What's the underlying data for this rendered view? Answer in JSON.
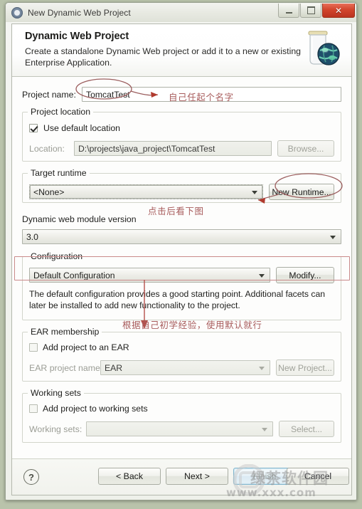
{
  "window": {
    "title": "New Dynamic Web Project",
    "icon": "eclipse-wizard-icon",
    "buttons": {
      "minimize": "minimize",
      "maximize": "maximize",
      "close": "✕"
    }
  },
  "banner": {
    "heading": "Dynamic Web Project",
    "description": "Create a standalone Dynamic Web project or add it to a new or existing Enterprise Application.",
    "icon": "jar-globe-icon"
  },
  "form": {
    "project_name_label": "Project name:",
    "project_name_value": "TomcatTest",
    "project_location": {
      "group_title": "Project location",
      "use_default_label": "Use default location",
      "use_default_checked": true,
      "location_label": "Location:",
      "location_value": "D:\\projects\\java_project\\TomcatTest",
      "browse_label": "Browse..."
    },
    "target_runtime": {
      "group_title": "Target runtime",
      "value": "<None>",
      "new_runtime_label": "New Runtime..."
    },
    "module_version": {
      "label": "Dynamic web module version",
      "value": "3.0"
    },
    "configuration": {
      "group_title": "Configuration",
      "value": "Default Configuration",
      "modify_label": "Modify...",
      "description": "The default configuration provides a good starting point. Additional facets can later be installed to add new functionality to the project."
    },
    "ear_membership": {
      "group_title": "EAR membership",
      "add_label": "Add project to an EAR",
      "add_checked": false,
      "ear_name_label": "EAR project name:",
      "ear_name_value": "EAR",
      "new_project_label": "New Project..."
    },
    "working_sets": {
      "group_title": "Working sets",
      "add_label": "Add project to working sets",
      "add_checked": false,
      "sets_label": "Working sets:",
      "sets_value": "",
      "select_label": "Select..."
    }
  },
  "annotations": [
    {
      "id": "name-note",
      "text": "自己任起个名字"
    },
    {
      "id": "runtime-note",
      "text": "点击后看下图"
    },
    {
      "id": "ear-note",
      "text": "根据自己初学经验，使用默认就行"
    }
  ],
  "footer": {
    "help_label": "?",
    "back_label": "< Back",
    "next_label": "Next >",
    "finish_label": "Finish",
    "cancel_label": "Cancel"
  },
  "watermark": {
    "site_name": "绿茶软件园",
    "url": "www.xxx.com"
  },
  "colors": {
    "annotation": "#a85c5c",
    "highlight_box": "#c98a8a",
    "close_button": "#d2452c",
    "dialog_bg": "#fdfdfc"
  }
}
